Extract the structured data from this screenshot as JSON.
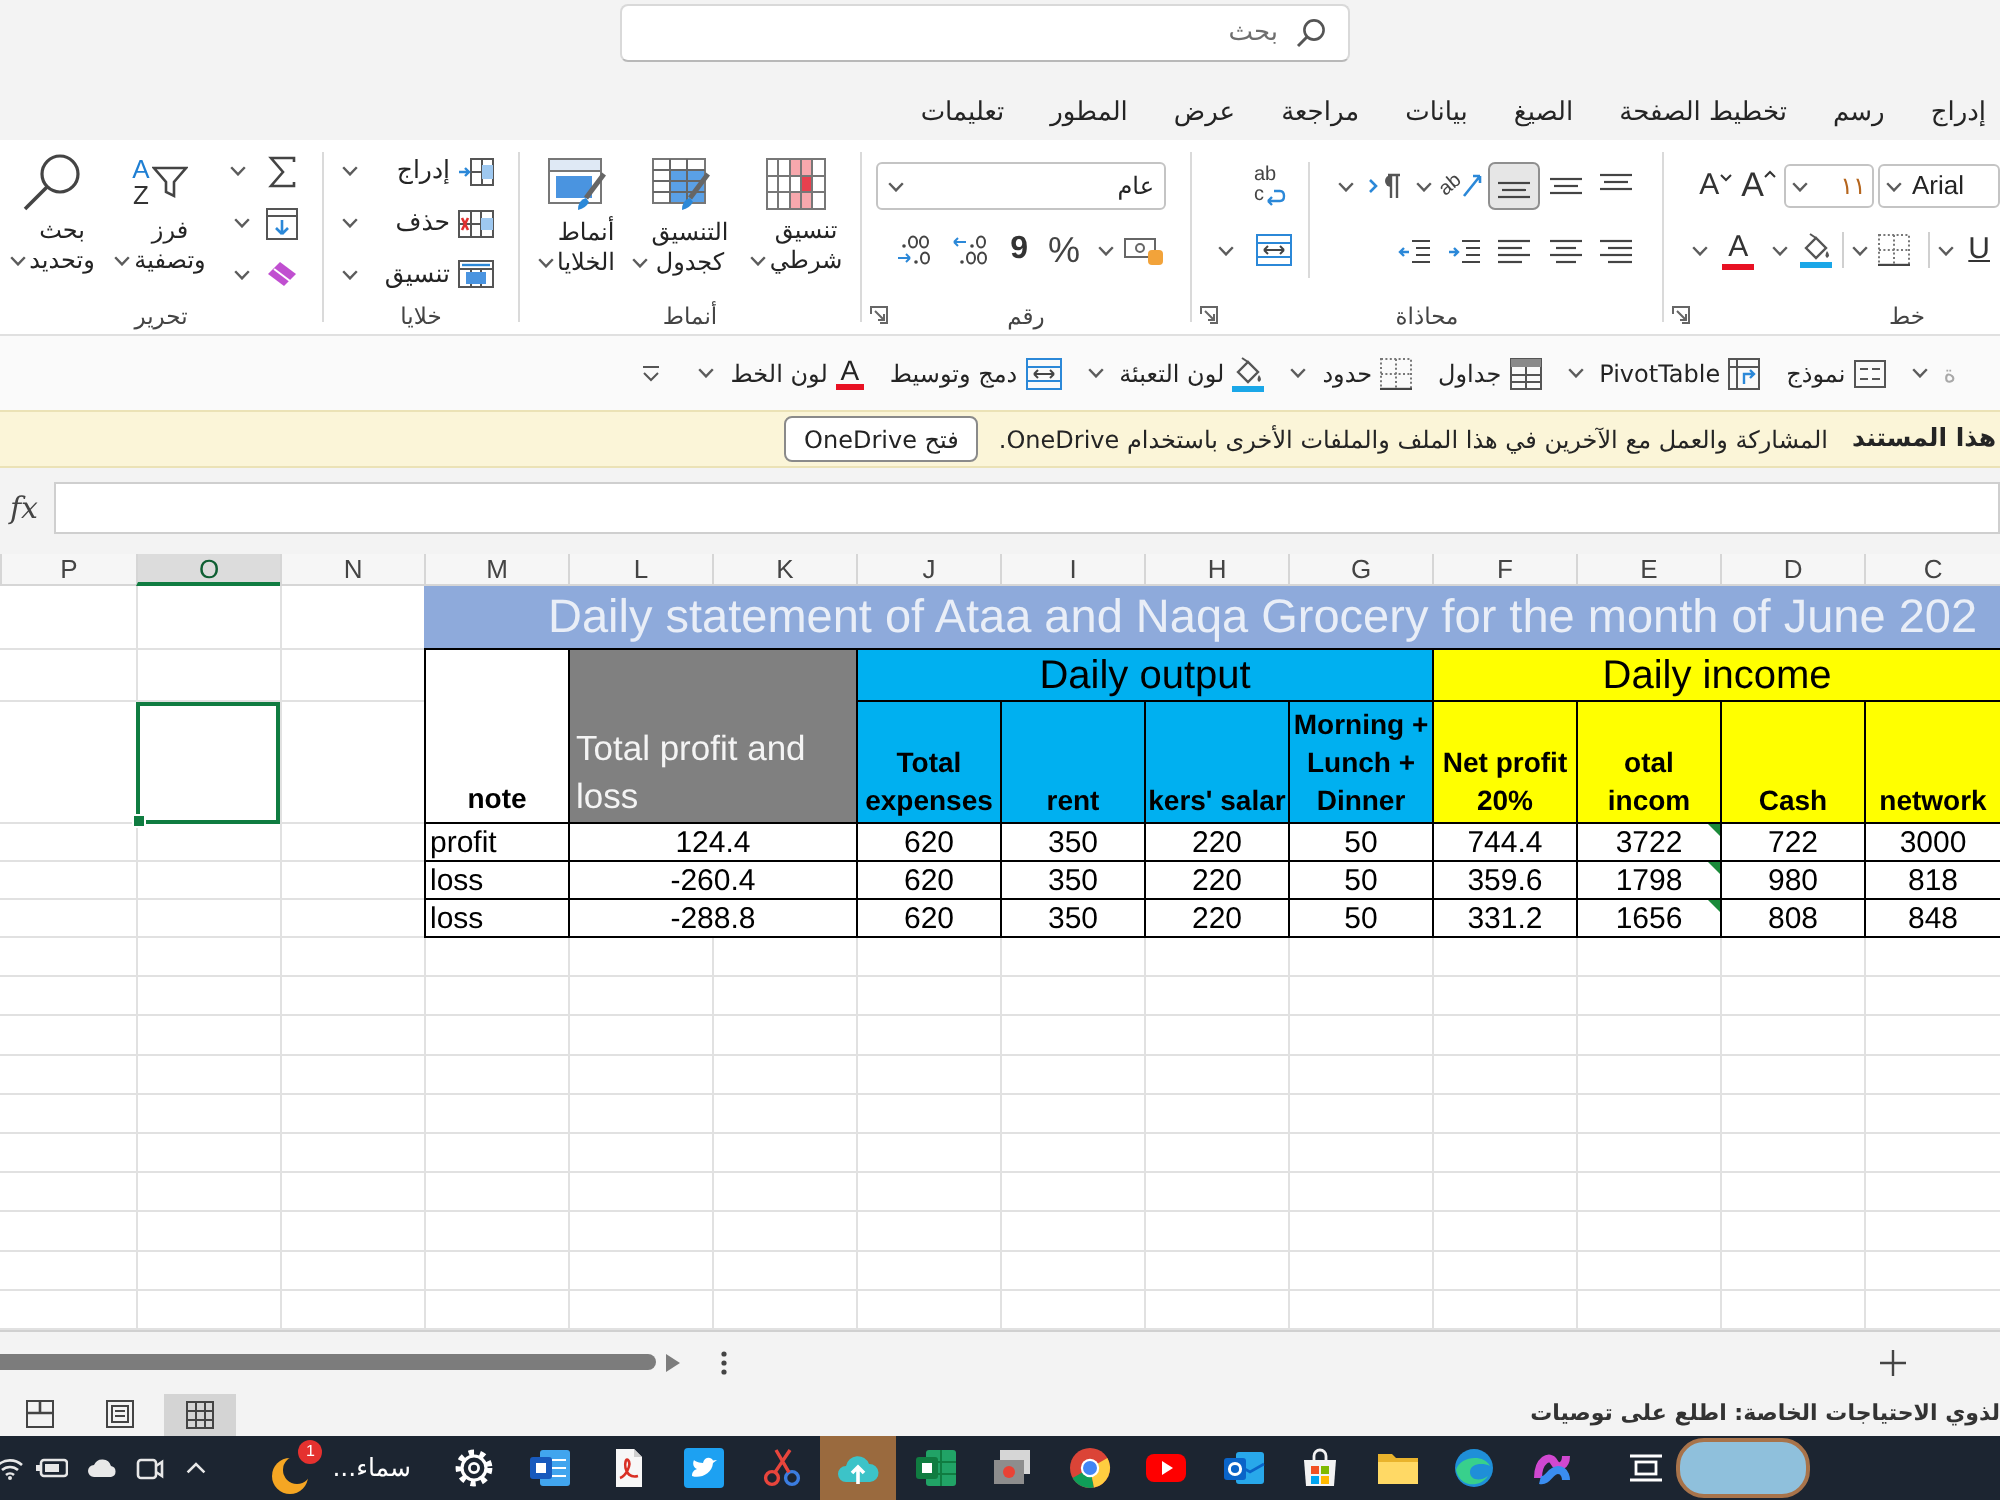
{
  "search": {
    "placeholder": "بحث"
  },
  "menu_tabs": [
    {
      "label": "إدراج",
      "selected": false
    },
    {
      "label": "رسم",
      "selected": false
    },
    {
      "label": "تخطيط الصفحة",
      "selected": false
    },
    {
      "label": "الصيغ",
      "selected": false
    },
    {
      "label": "بيانات",
      "selected": false
    },
    {
      "label": "مراجعة",
      "selected": false
    },
    {
      "label": "عرض",
      "selected": false
    },
    {
      "label": "المطور",
      "selected": false
    },
    {
      "label": "تعليمات",
      "selected": false
    }
  ],
  "ribbon": {
    "font": {
      "label": "خط",
      "launcher": true,
      "font_name": "Arial",
      "font_size": "١١",
      "grow_glyph": "A",
      "shrink_glyph": "A",
      "underline_glyph": "U",
      "color_glyph": "A"
    },
    "alignment": {
      "label": "محاذاة",
      "launcher": true,
      "vertical_align": [
        {
          "selected": false
        },
        {
          "selected": false
        },
        {
          "selected": true
        }
      ],
      "orientation_glyph": "ab",
      "wrap_glyphs": [
        "ab",
        "c"
      ]
    },
    "number": {
      "label": "رقم",
      "launcher": true,
      "format": "عام",
      "percent_glyph": "%",
      "comma_glyph": "9"
    },
    "styles": {
      "label": "أنماط",
      "buttons": [
        "تنسيق شرطي",
        "التنسيق كجدول",
        "أنماط الخلايا"
      ]
    },
    "cells": {
      "label": "خلايا",
      "buttons": [
        "إدراج",
        "حذف",
        "تنسيق"
      ]
    },
    "editing": {
      "label": "تحرير",
      "sort_glyphs": [
        "A",
        "Z"
      ],
      "buttons": [
        "فرز وتصفية",
        "بحث وتحديد"
      ]
    }
  },
  "quick_toolbar": [
    {
      "label": "ة",
      "disabled": true,
      "dropdown": true
    },
    {
      "label": "نموذج",
      "disabled": false,
      "dropdown": false
    },
    {
      "label": "PivotTable",
      "disabled": false,
      "dropdown": true
    },
    {
      "label": "جداول",
      "disabled": false,
      "dropdown": false
    },
    {
      "label": "حدود",
      "disabled": false,
      "dropdown": true
    },
    {
      "label": "لون التعبئة",
      "disabled": false,
      "dropdown": true
    },
    {
      "label": "دمج وتوسيط",
      "disabled": false,
      "dropdown": false
    },
    {
      "label": "لون الخط",
      "disabled": false,
      "dropdown": true,
      "glyph": "A"
    }
  ],
  "info_bar": {
    "title": "هذا المستند",
    "message": "المشاركة والعمل مع الآخرين في هذا الملف والملفات الأخرى باستخدام OneDrive.",
    "button": "فتح OneDrive"
  },
  "formula_bar": {
    "label": "fx"
  },
  "sheet": {
    "columns": [
      {
        "label": "C",
        "selected": false
      },
      {
        "label": "D",
        "selected": false
      },
      {
        "label": "E",
        "selected": false
      },
      {
        "label": "F",
        "selected": false
      },
      {
        "label": "G",
        "selected": false
      },
      {
        "label": "H",
        "selected": false
      },
      {
        "label": "I",
        "selected": false
      },
      {
        "label": "J",
        "selected": false
      },
      {
        "label": "K",
        "selected": false
      },
      {
        "label": "L",
        "selected": false
      },
      {
        "label": "M",
        "selected": false
      },
      {
        "label": "N",
        "selected": false
      },
      {
        "label": "O",
        "selected": true
      },
      {
        "label": "P",
        "selected": false
      }
    ],
    "title": "Daily statement of Ataa and Naqa Grocery for the month of June 202",
    "groups": [
      {
        "label": "Daily income",
        "color": "#ffff00",
        "headers": [
          "network",
          "Cash",
          "otal incom",
          "Net profit 20%"
        ]
      },
      {
        "label": "Daily output",
        "color": "#00b0f0",
        "headers": [
          "Morning + Lunch + Dinner",
          "kers' salar",
          "rent",
          "Total expenses"
        ]
      }
    ],
    "total_header": "Total profit and loss",
    "note_header": "note",
    "rows": [
      {
        "values": [
          "3000",
          "722",
          "3722",
          "744.4",
          "50",
          "220",
          "350",
          "620"
        ],
        "total": "124.4",
        "note": "profit",
        "error_mark": true
      },
      {
        "values": [
          "818",
          "980",
          "1798",
          "359.6",
          "50",
          "220",
          "350",
          "620"
        ],
        "total": "-260.4",
        "note": "loss",
        "error_mark": true
      },
      {
        "values": [
          "848",
          "808",
          "1656",
          "331.2",
          "50",
          "220",
          "350",
          "620"
        ],
        "total": "-288.8",
        "note": "loss",
        "error_mark": true
      }
    ]
  },
  "status_bar": {
    "message": "لذوي الاحتياجات الخاصة: اطلع على توصيات",
    "views": [
      {
        "selected": true
      },
      {
        "selected": false
      },
      {
        "selected": false
      }
    ]
  },
  "taskbar": {
    "apps": [
      {
        "selected": false
      },
      {
        "selected": false
      },
      {
        "selected": false
      },
      {
        "selected": false
      },
      {
        "selected": false
      },
      {
        "selected": false
      },
      {
        "selected": false
      },
      {
        "selected": false
      },
      {
        "selected": false
      },
      {
        "selected": false
      },
      {
        "selected": true
      },
      {
        "selected": false
      },
      {
        "selected": false
      },
      {
        "selected": false
      },
      {
        "selected": false
      },
      {
        "selected": false
      }
    ],
    "user_app": {
      "label": "سماء...",
      "badge": "1"
    }
  }
}
